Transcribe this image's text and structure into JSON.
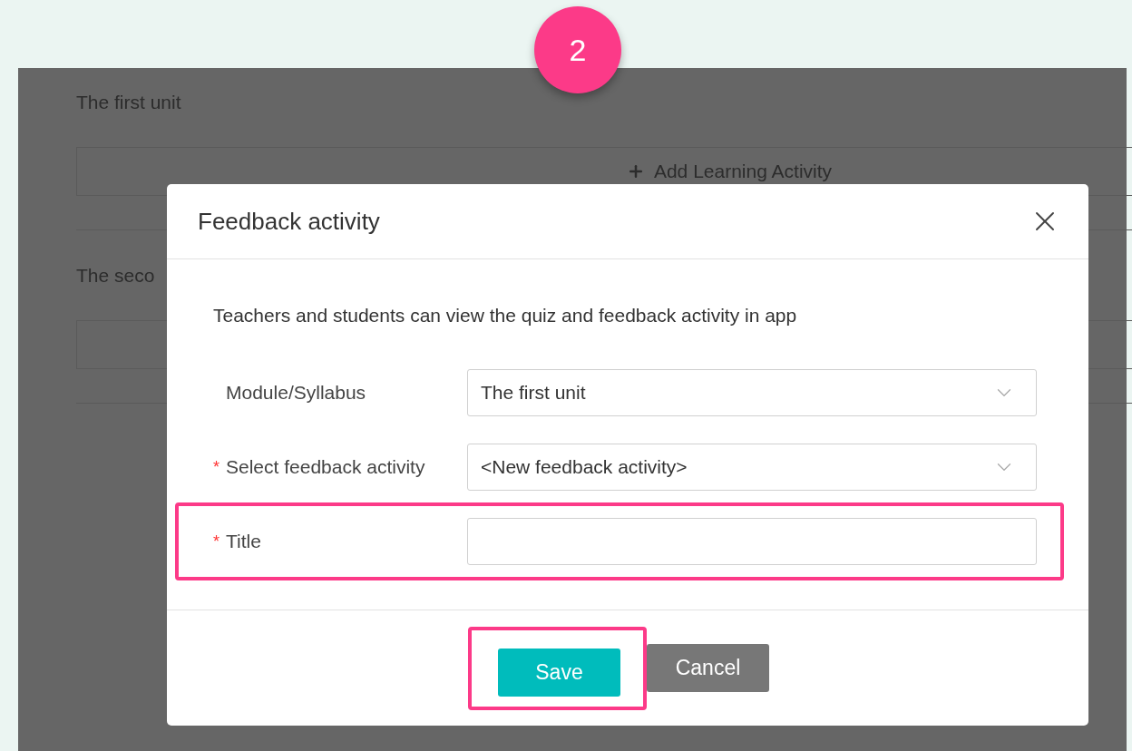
{
  "step_badge": "2",
  "page": {
    "sections": [
      {
        "title": "The first unit",
        "add_button": "Add Learning Activity"
      },
      {
        "title": "The seco"
      }
    ]
  },
  "dialog": {
    "title": "Feedback activity",
    "intro": "Teachers and students can view the quiz and feedback activity in app",
    "fields": [
      {
        "kind": "select",
        "label": "Module/Syllabus",
        "highlighted": false,
        "value": "The first unit"
      },
      {
        "kind": "select",
        "required_mark": "*",
        "label": "Select feedback activity",
        "highlighted": false,
        "value": "<New feedback activity>"
      },
      {
        "kind": "text",
        "required_mark": "*",
        "label": "Title",
        "highlighted": true
      }
    ],
    "buttons": [
      {
        "label": "Save",
        "kind": "primary",
        "highlighted": true
      },
      {
        "label": "Cancel",
        "kind": "secondary",
        "highlighted": false
      }
    ]
  }
}
